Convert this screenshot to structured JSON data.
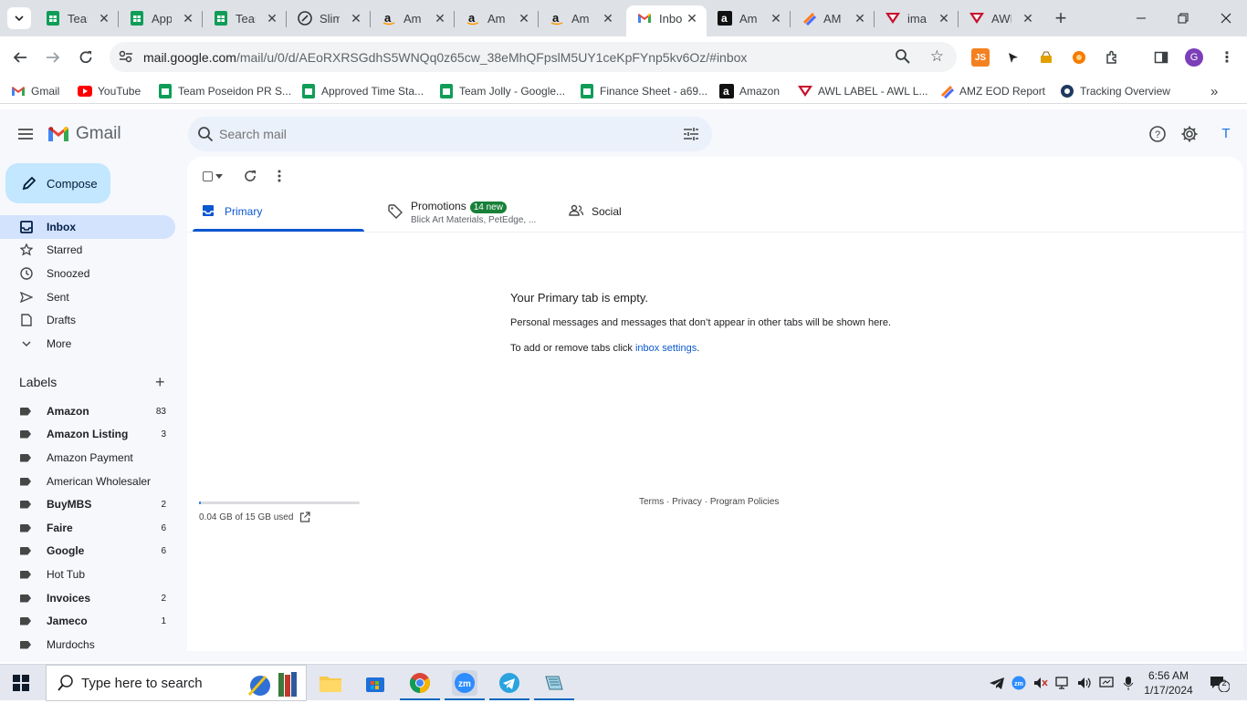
{
  "browser": {
    "tabs": [
      {
        "title": "Tear",
        "icon": "sheets-icon"
      },
      {
        "title": "App",
        "icon": "sheets-icon"
      },
      {
        "title": "Tear",
        "icon": "sheets-icon"
      },
      {
        "title": "Slim",
        "icon": "slim-icon"
      },
      {
        "title": "Am",
        "icon": "amazon-icon"
      },
      {
        "title": "Am",
        "icon": "amazon-icon"
      },
      {
        "title": "Am",
        "icon": "amazon-icon"
      },
      {
        "title": "Inbo",
        "icon": "gmail-icon",
        "active": true
      },
      {
        "title": "Am",
        "icon": "amazon-dark-icon"
      },
      {
        "title": "AM",
        "icon": "clickup-icon"
      },
      {
        "title": "ima",
        "icon": "awl-icon"
      },
      {
        "title": "AWI",
        "icon": "awl-icon"
      }
    ],
    "url_host": "mail.google.com",
    "url_path": "/mail/u/0/d/AEoRXRSGdhS5WNQq0z65cw_38eMhQFpslM5UY1ceKpFYnp5kv6Oz/#inbox",
    "profile_initial": "G",
    "ext_js_label": "JS",
    "bookmarks": [
      {
        "label": "Gmail",
        "icon": "gmail-icon"
      },
      {
        "label": "YouTube",
        "icon": "youtube-icon"
      },
      {
        "label": "Team Poseidon PR S...",
        "icon": "sheets-icon"
      },
      {
        "label": "Approved Time Sta...",
        "icon": "sheets-icon"
      },
      {
        "label": "Team Jolly - Google...",
        "icon": "sheets-icon"
      },
      {
        "label": "Finance Sheet - a69...",
        "icon": "sheets-icon"
      },
      {
        "label": "Amazon",
        "icon": "amazon-dark-icon"
      },
      {
        "label": "AWL LABEL - AWL L...",
        "icon": "awl-icon"
      },
      {
        "label": "AMZ EOD Report",
        "icon": "clickup-icon"
      },
      {
        "label": "Tracking Overview",
        "icon": "tracking-icon"
      }
    ]
  },
  "gmail": {
    "logo_text": "Gmail",
    "search_placeholder": "Search mail",
    "avatar_initial": "T",
    "compose_label": "Compose",
    "nav": [
      {
        "label": "Inbox",
        "icon": "inbox-icon",
        "active": true
      },
      {
        "label": "Starred",
        "icon": "star-icon"
      },
      {
        "label": "Snoozed",
        "icon": "clock-icon"
      },
      {
        "label": "Sent",
        "icon": "send-icon"
      },
      {
        "label": "Drafts",
        "icon": "draft-icon"
      },
      {
        "label": "More",
        "icon": "chevron-down-icon"
      }
    ],
    "labels_heading": "Labels",
    "labels": [
      {
        "name": "Amazon",
        "count": "83",
        "bold": true
      },
      {
        "name": "Amazon Listing",
        "count": "3",
        "bold": true
      },
      {
        "name": "Amazon Payment",
        "count": "",
        "bold": false
      },
      {
        "name": "American Wholesaler",
        "count": "",
        "bold": false
      },
      {
        "name": "BuyMBS",
        "count": "2",
        "bold": true
      },
      {
        "name": "Faire",
        "count": "6",
        "bold": true
      },
      {
        "name": "Google",
        "count": "6",
        "bold": true
      },
      {
        "name": "Hot Tub",
        "count": "",
        "bold": false
      },
      {
        "name": "Invoices",
        "count": "2",
        "bold": true
      },
      {
        "name": "Jameco",
        "count": "1",
        "bold": true
      },
      {
        "name": "Murdochs",
        "count": "",
        "bold": false
      }
    ],
    "tabs": {
      "primary": "Primary",
      "promotions": "Promotions",
      "promotions_badge": "14 new",
      "promotions_senders": "Blick Art Materials, PetEdge, ...",
      "social": "Social"
    },
    "empty": {
      "title": "Your Primary tab is empty.",
      "line1": "Personal messages and messages that don’t appear in other tabs will be shown here.",
      "line2_prefix": "To add or remove tabs click ",
      "line2_link": "inbox settings",
      "line2_suffix": "."
    },
    "storage": {
      "text": "0.04 GB of 15 GB used",
      "fraction": 0.003
    },
    "footer": {
      "terms": "Terms",
      "privacy": "Privacy",
      "policies": "Program Policies",
      "sep": " · "
    }
  },
  "taskbar": {
    "search_placeholder": "Type here to search",
    "time": "6:56 AM",
    "date": "1/17/2024",
    "notification_count": "2"
  },
  "colors": {
    "accent": "#0b57d0",
    "compose_bg": "#c2e7ff",
    "active_nav_bg": "#d3e3fd",
    "badge_green": "#188038"
  }
}
